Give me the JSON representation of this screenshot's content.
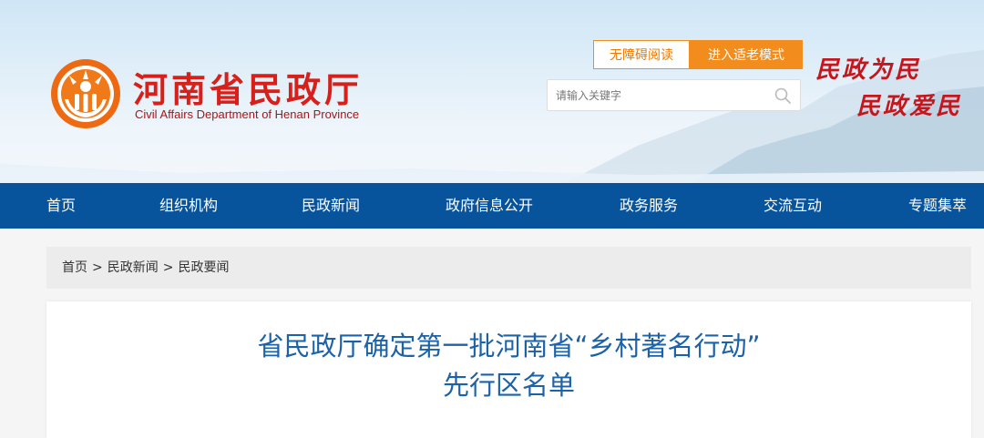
{
  "header": {
    "site_title": "河南省民政厅",
    "site_subtitle": "Civil Affairs Department of Henan Province",
    "accessible_label": "无障碍阅读",
    "elder_mode_label": "进入适老模式",
    "search_placeholder": "请输入关键字",
    "slogan_line1": "民政为民",
    "slogan_line2": "民政爱民"
  },
  "nav": {
    "items": [
      "首页",
      "组织机构",
      "民政新闻",
      "政府信息公开",
      "政务服务",
      "交流互动",
      "专题集萃"
    ]
  },
  "breadcrumb": {
    "items": [
      "首页",
      "民政新闻",
      "民政要闻"
    ],
    "separator": ">"
  },
  "article": {
    "title_line1": "省民政厅确定第一批河南省“乡村著名行动”",
    "title_line2": "先行区名单"
  },
  "colors": {
    "brand_red": "#d8201a",
    "nav_blue": "#08549c",
    "accent_orange": "#f28c1c",
    "title_blue": "#1c62a8"
  },
  "icons": {
    "logo": "hands-sun-emblem-icon",
    "search": "search-icon"
  }
}
